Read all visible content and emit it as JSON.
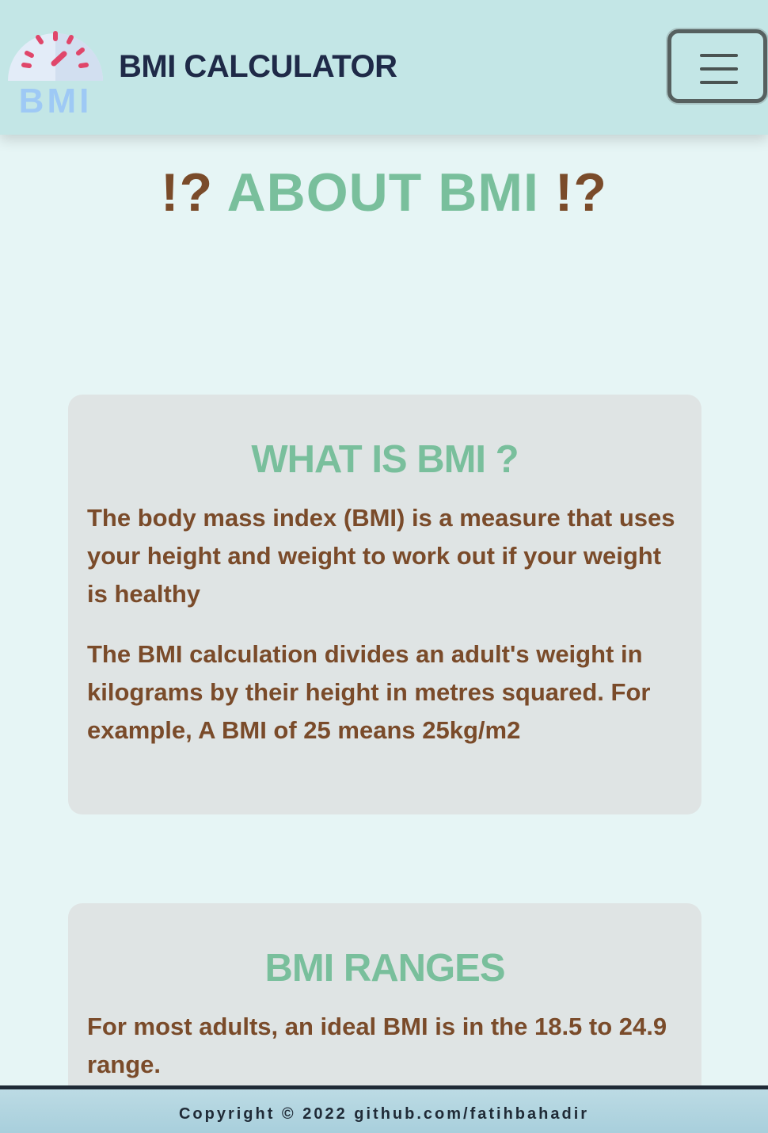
{
  "header": {
    "brand_title": "BMI CALCULATOR",
    "logo_text": "BMI",
    "menu_icon": "hamburger-menu-icon"
  },
  "main": {
    "title_prefix": "!?",
    "title_text": "ABOUT BMI",
    "title_suffix": "!?"
  },
  "cards": [
    {
      "heading": "WHAT IS BMI ?",
      "paragraphs": [
        "The body mass index (BMI) is a measure that uses your height and weight to work out if your weight is healthy",
        "The BMI calculation divides an adult's weight in kilograms by their height in metres squared. For example, A BMI of 25 means 25kg/m2"
      ]
    },
    {
      "heading": "BMI RANGES",
      "paragraphs": [
        "For most adults, an ideal BMI is in the 18.5 to 24.9 range."
      ]
    }
  ],
  "footer": {
    "copyright": "Copyright © 2022 github.com/fatihbahadir"
  },
  "colors": {
    "header_bg": "#c3e6e6",
    "page_bg": "#e6f5f5",
    "card_bg": "#dfe4e4",
    "accent_green": "#79bf9c",
    "text_brown": "#7a4b2a",
    "navy": "#1f2a48"
  }
}
